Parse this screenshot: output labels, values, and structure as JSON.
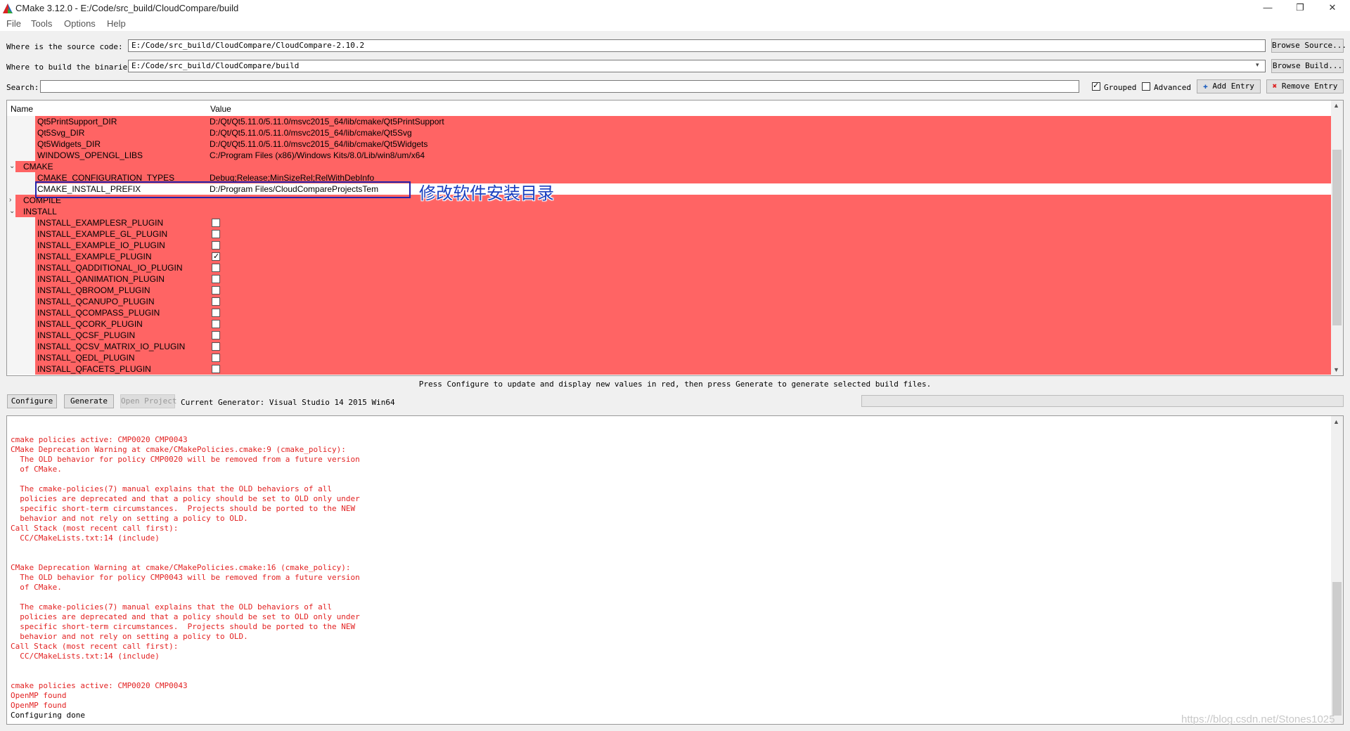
{
  "window": {
    "title": "CMake 3.12.0 - E:/Code/src_build/CloudCompare/build",
    "minimize": "—",
    "restore": "❐",
    "close": "✕"
  },
  "menu": [
    "File",
    "Tools",
    "Options",
    "Help"
  ],
  "source": {
    "label": "Where is the source code:",
    "value": "E:/Code/src_build/CloudCompare/CloudCompare-2.10.2",
    "browse": "Browse Source..."
  },
  "build": {
    "label": "Where to build the binaries:",
    "value": "E:/Code/src_build/CloudCompare/build",
    "browse": "Browse Build..."
  },
  "search": {
    "label": "Search:",
    "value": "",
    "grouped_label": "Grouped",
    "grouped_checked": true,
    "advanced_label": "Advanced",
    "advanced_checked": false,
    "add_entry": "Add Entry",
    "remove_entry": "Remove Entry"
  },
  "tree": {
    "col_name": "Name",
    "col_value": "Value",
    "rows": [
      {
        "kind": "entry",
        "name": "Qt5PrintSupport_DIR",
        "value": "D:/Qt/Qt5.11.0/5.11.0/msvc2015_64/lib/cmake/Qt5PrintSupport"
      },
      {
        "kind": "entry",
        "name": "Qt5Svg_DIR",
        "value": "D:/Qt/Qt5.11.0/5.11.0/msvc2015_64/lib/cmake/Qt5Svg"
      },
      {
        "kind": "entry",
        "name": "Qt5Widgets_DIR",
        "value": "D:/Qt/Qt5.11.0/5.11.0/msvc2015_64/lib/cmake/Qt5Widgets"
      },
      {
        "kind": "entry",
        "name": "WINDOWS_OPENGL_LIBS",
        "value": "C:/Program Files (x86)/Windows Kits/8.0/Lib/win8/um/x64"
      },
      {
        "kind": "group",
        "name": "CMAKE",
        "expanded": true
      },
      {
        "kind": "entry",
        "name": "CMAKE_CONFIGURATION_TYPES",
        "value": "Debug;Release;MinSizeRel;RelWithDebInfo"
      },
      {
        "kind": "entry",
        "name": "CMAKE_INSTALL_PREFIX",
        "value": "D:/Program Files/CloudCompareProjectsTem",
        "selected": true
      },
      {
        "kind": "group",
        "name": "COMPILE",
        "expanded": false
      },
      {
        "kind": "group",
        "name": "INSTALL",
        "expanded": true
      },
      {
        "kind": "bool",
        "name": "INSTALL_EXAMPLESR_PLUGIN",
        "checked": false
      },
      {
        "kind": "bool",
        "name": "INSTALL_EXAMPLE_GL_PLUGIN",
        "checked": false
      },
      {
        "kind": "bool",
        "name": "INSTALL_EXAMPLE_IO_PLUGIN",
        "checked": false
      },
      {
        "kind": "bool",
        "name": "INSTALL_EXAMPLE_PLUGIN",
        "checked": true
      },
      {
        "kind": "bool",
        "name": "INSTALL_QADDITIONAL_IO_PLUGIN",
        "checked": false
      },
      {
        "kind": "bool",
        "name": "INSTALL_QANIMATION_PLUGIN",
        "checked": false
      },
      {
        "kind": "bool",
        "name": "INSTALL_QBROOM_PLUGIN",
        "checked": false
      },
      {
        "kind": "bool",
        "name": "INSTALL_QCANUPO_PLUGIN",
        "checked": false
      },
      {
        "kind": "bool",
        "name": "INSTALL_QCOMPASS_PLUGIN",
        "checked": false
      },
      {
        "kind": "bool",
        "name": "INSTALL_QCORK_PLUGIN",
        "checked": false
      },
      {
        "kind": "bool",
        "name": "INSTALL_QCSF_PLUGIN",
        "checked": false
      },
      {
        "kind": "bool",
        "name": "INSTALL_QCSV_MATRIX_IO_PLUGIN",
        "checked": false
      },
      {
        "kind": "bool",
        "name": "INSTALL_QEDL_PLUGIN",
        "checked": false
      },
      {
        "kind": "bool",
        "name": "INSTALL_QFACETS_PLUGIN",
        "checked": false
      }
    ]
  },
  "annotation": "修改软件安装目录",
  "hint": "Press Configure to update and display new values in red, then press Generate to generate selected build files.",
  "actions": {
    "configure": "Configure",
    "generate": "Generate",
    "open_project": "Open Project",
    "generator": "Current Generator: Visual Studio 14 2015 Win64"
  },
  "log": [
    {
      "text": "cmake policies active: CMP0020 CMP0043",
      "color": "#e22222"
    },
    {
      "text": "CMake Deprecation Warning at cmake/CMakePolicies.cmake:9 (cmake_policy):",
      "color": "#e22222"
    },
    {
      "text": "  The OLD behavior for policy CMP0020 will be removed from a future version",
      "color": "#e22222"
    },
    {
      "text": "  of CMake.",
      "color": "#e22222"
    },
    {
      "text": "",
      "color": "#e22222"
    },
    {
      "text": "  The cmake-policies(7) manual explains that the OLD behaviors of all",
      "color": "#e22222"
    },
    {
      "text": "  policies are deprecated and that a policy should be set to OLD only under",
      "color": "#e22222"
    },
    {
      "text": "  specific short-term circumstances.  Projects should be ported to the NEW",
      "color": "#e22222"
    },
    {
      "text": "  behavior and not rely on setting a policy to OLD.",
      "color": "#e22222"
    },
    {
      "text": "Call Stack (most recent call first):",
      "color": "#e22222"
    },
    {
      "text": "  CC/CMakeLists.txt:14 (include)",
      "color": "#e22222"
    },
    {
      "text": "",
      "color": "#e22222"
    },
    {
      "text": "",
      "color": "#e22222"
    },
    {
      "text": "CMake Deprecation Warning at cmake/CMakePolicies.cmake:16 (cmake_policy):",
      "color": "#e22222"
    },
    {
      "text": "  The OLD behavior for policy CMP0043 will be removed from a future version",
      "color": "#e22222"
    },
    {
      "text": "  of CMake.",
      "color": "#e22222"
    },
    {
      "text": "",
      "color": "#e22222"
    },
    {
      "text": "  The cmake-policies(7) manual explains that the OLD behaviors of all",
      "color": "#e22222"
    },
    {
      "text": "  policies are deprecated and that a policy should be set to OLD only under",
      "color": "#e22222"
    },
    {
      "text": "  specific short-term circumstances.  Projects should be ported to the NEW",
      "color": "#e22222"
    },
    {
      "text": "  behavior and not rely on setting a policy to OLD.",
      "color": "#e22222"
    },
    {
      "text": "Call Stack (most recent call first):",
      "color": "#e22222"
    },
    {
      "text": "  CC/CMakeLists.txt:14 (include)",
      "color": "#e22222"
    },
    {
      "text": "",
      "color": "#e22222"
    },
    {
      "text": "",
      "color": "#e22222"
    },
    {
      "text": "cmake policies active: CMP0020 CMP0043",
      "color": "#e22222"
    },
    {
      "text": "OpenMP found",
      "color": "#e22222"
    },
    {
      "text": "OpenMP found",
      "color": "#e22222"
    },
    {
      "text": "Configuring done",
      "color": "#000000"
    }
  ],
  "watermark": "https://blog.csdn.net/Stones1025",
  "colors": {
    "changed_entry": "#ff6464",
    "annotation": "#1a3fbf"
  }
}
